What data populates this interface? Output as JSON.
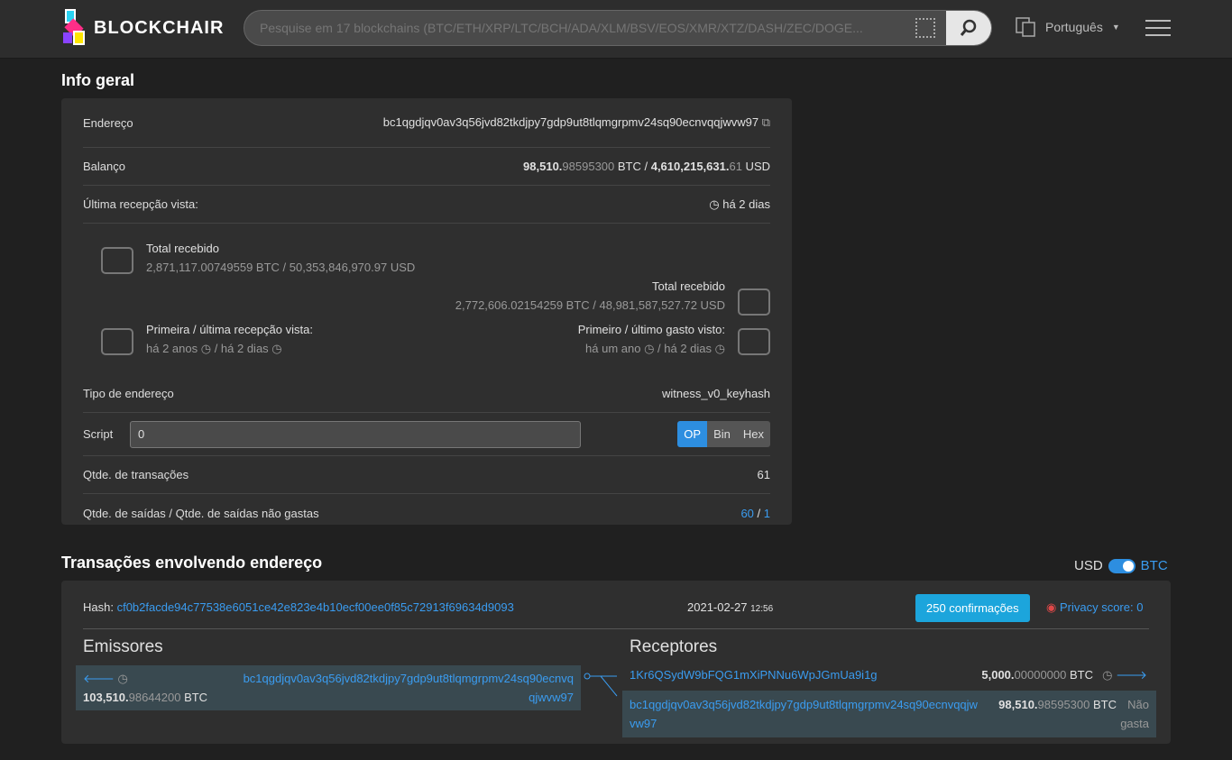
{
  "header": {
    "brand": "BLOCKCHAIR",
    "search_placeholder": "Pesquise em 17 blockchains (BTC/ETH/XRP/LTC/BCH/ADA/XLM/BSV/EOS/XMR/XTZ/DASH/ZEC/DOGE...",
    "language": "Português"
  },
  "info": {
    "title": "Info geral",
    "address_label": "Endereço",
    "address": "bc1qgdjqv0av3q56jvd82tkdjpy7gdp9ut8tlqmgrpmv24sq90ecnvqqjwvw97",
    "balance_label": "Balanço",
    "balance_btc_int": "98,510.",
    "balance_btc_dec": "98595300",
    "balance_btc_unit": " BTC / ",
    "balance_usd_int": "4,610,215,631.",
    "balance_usd_dec": "61",
    "balance_usd_unit": " USD",
    "last_seen_label": "Última recepção vista:",
    "last_seen": "há 2 dias",
    "received_label": "Total recebido",
    "received_value": "2,871,117.00749559 BTC / 50,353,846,970.97 USD",
    "spent_label": "Total recebido",
    "spent_value": "2,772,606.02154259 BTC / 48,981,587,527.72 USD",
    "first_last_recv_label": "Primeira / última recepção vista:",
    "first_recv": "há 2 anos",
    "last_recv": "/ há 2 dias",
    "first_last_spent_label": "Primeiro / último gasto visto:",
    "first_spent": "há um ano",
    "last_spent": "/ há 2 dias",
    "type_label": "Tipo de endereço",
    "type": "witness_v0_keyhash",
    "script_label": "Script",
    "script_value": "0",
    "script_modes": [
      "OP",
      "Bin",
      "Hex"
    ],
    "tx_count_label": "Qtde. de transações",
    "tx_count": "61",
    "outputs_label": "Qtde. de saídas / Qtde. de saídas não gastas",
    "outputs": "60",
    "outputs_sep": " / ",
    "unspent": "1"
  },
  "tx": {
    "title": "Transações envolvendo endereço",
    "toggle_left": "USD",
    "toggle_right": "BTC",
    "hash_label": "Hash: ",
    "hash": "cf0b2facde94c77538e6051ce42e823e4b10ecf00ee0f85c72913f69634d9093",
    "date": "2021-02-27",
    "time": "12:56",
    "confirmations": "250 confirmações",
    "privacy": "Privacy score: 0",
    "senders_title": "Emissores",
    "receivers_title": "Receptores",
    "input": {
      "address": "bc1qgdjqv0av3q56jvd82tkdjpy7gdp9ut8tlqmgrpmv24sq90ecnvqqjwvw97",
      "amount_int": "103,510.",
      "amount_dec": "98644200",
      "unit": " BTC"
    },
    "outputs": [
      {
        "address": "1Kr6QSydW9bFQG1mXiPNNu6WpJGmUa9i1g",
        "amount_int": "5,000.",
        "amount_dec": "00000000",
        "unit": " BTC",
        "status": ""
      },
      {
        "address": "bc1qgdjqv0av3q56jvd82tkdjpy7gdp9ut8tlqmgrpmv24sq90ecnvqqjwvw97",
        "amount_int": "98,510.",
        "amount_dec": "98595300",
        "unit": " BTC",
        "status": "Não gasta"
      }
    ]
  }
}
